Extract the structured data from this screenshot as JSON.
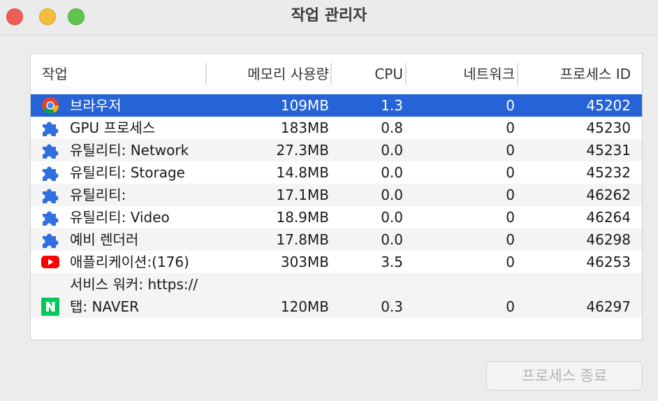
{
  "window": {
    "title": "작업 관리자"
  },
  "table": {
    "columns": {
      "task": "작업",
      "memory": "메모리 사용량",
      "cpu": "CPU",
      "network": "네트워크",
      "pid": "프로세스 ID"
    },
    "rows": [
      {
        "icon": "chrome-icon",
        "name": "브라우저",
        "memory": "109MB",
        "cpu": "1.3",
        "network": "0",
        "pid": "45202",
        "selected": true
      },
      {
        "icon": "puzzle-icon",
        "name": "GPU 프로세스",
        "memory": "183MB",
        "cpu": "0.8",
        "network": "0",
        "pid": "45230"
      },
      {
        "icon": "puzzle-icon",
        "name": "유틸리티: Network",
        "memory": "27.3MB",
        "cpu": "0.0",
        "network": "0",
        "pid": "45231"
      },
      {
        "icon": "puzzle-icon",
        "name": "유틸리티: Storage",
        "memory": "14.8MB",
        "cpu": "0.0",
        "network": "0",
        "pid": "45232"
      },
      {
        "icon": "puzzle-icon",
        "name": "유틸리티:",
        "memory": "17.1MB",
        "cpu": "0.0",
        "network": "0",
        "pid": "46262"
      },
      {
        "icon": "puzzle-icon",
        "name": "유틸리티: Video",
        "memory": "18.9MB",
        "cpu": "0.0",
        "network": "0",
        "pid": "46264"
      },
      {
        "icon": "puzzle-icon",
        "name": "예비 렌더러",
        "memory": "17.8MB",
        "cpu": "0.0",
        "network": "0",
        "pid": "46298"
      },
      {
        "icon": "youtube-icon",
        "name": "애플리케이션:(176)",
        "memory": "303MB",
        "cpu": "3.5",
        "network": "0",
        "pid": "46253"
      },
      {
        "icon": "naver-icon",
        "name_line1": "서비스 워커: https://",
        "name": "탭: NAVER",
        "memory": "120MB",
        "cpu": "0.3",
        "network": "0",
        "pid": "46297"
      }
    ]
  },
  "actions": {
    "end_process": "프로세스 종료"
  },
  "colors": {
    "selection": "#2563d6",
    "puzzle": "#2f6fe0",
    "youtube": "#ff0000",
    "naver": "#03c75a"
  }
}
